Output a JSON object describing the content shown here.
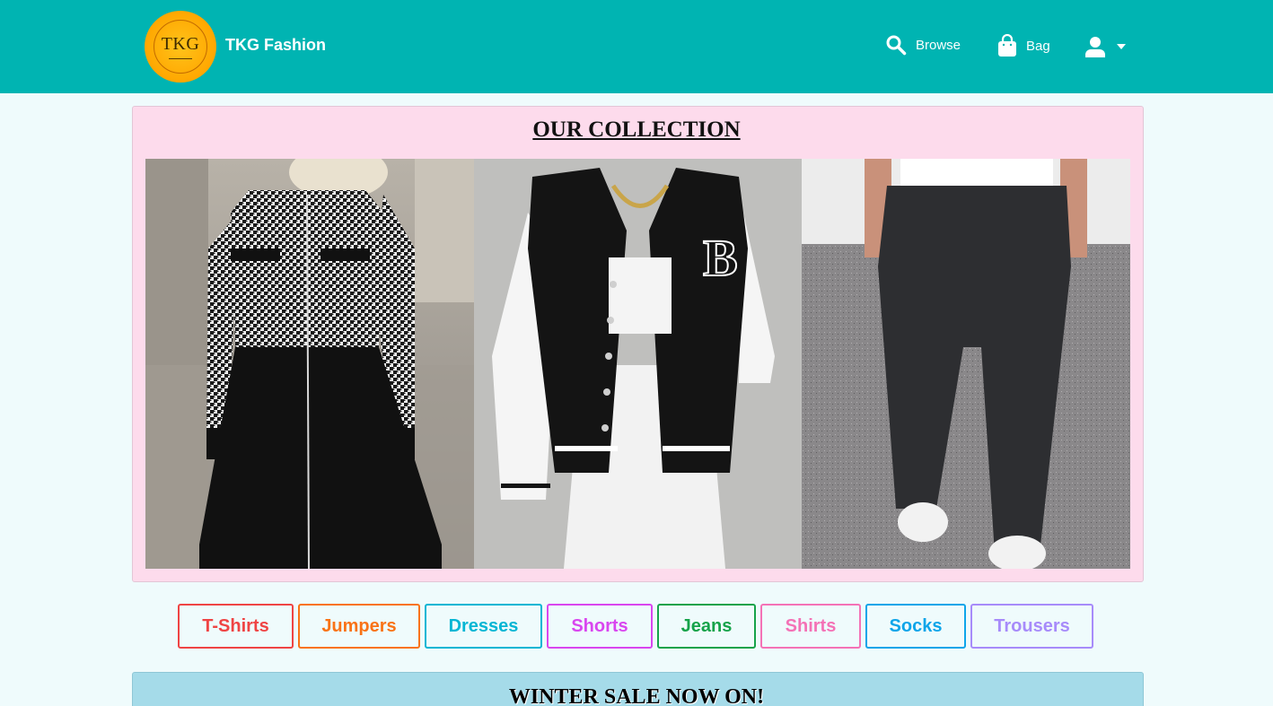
{
  "navbar": {
    "logo_text": "TKG",
    "brand": "TKG Fashion",
    "browse_label": "Browse",
    "bag_label": "Bag",
    "bg_color": "#00b4b2"
  },
  "collection": {
    "title": "OUR COLLECTION",
    "bg_color": "#fddbec"
  },
  "categories": [
    {
      "label": "T-Shirts",
      "color": "#ef4444"
    },
    {
      "label": "Jumpers",
      "color": "#f97316"
    },
    {
      "label": "Dresses",
      "color": "#06b6d4"
    },
    {
      "label": "Shorts",
      "color": "#d946ef"
    },
    {
      "label": "Jeans",
      "color": "#16a34a"
    },
    {
      "label": "Shirts",
      "color": "#f472b6"
    },
    {
      "label": "Socks",
      "color": "#0ea5e9"
    },
    {
      "label": "Trousers",
      "color": "#a78bfa"
    }
  ],
  "sale": {
    "title": "WINTER SALE NOW ON!"
  }
}
